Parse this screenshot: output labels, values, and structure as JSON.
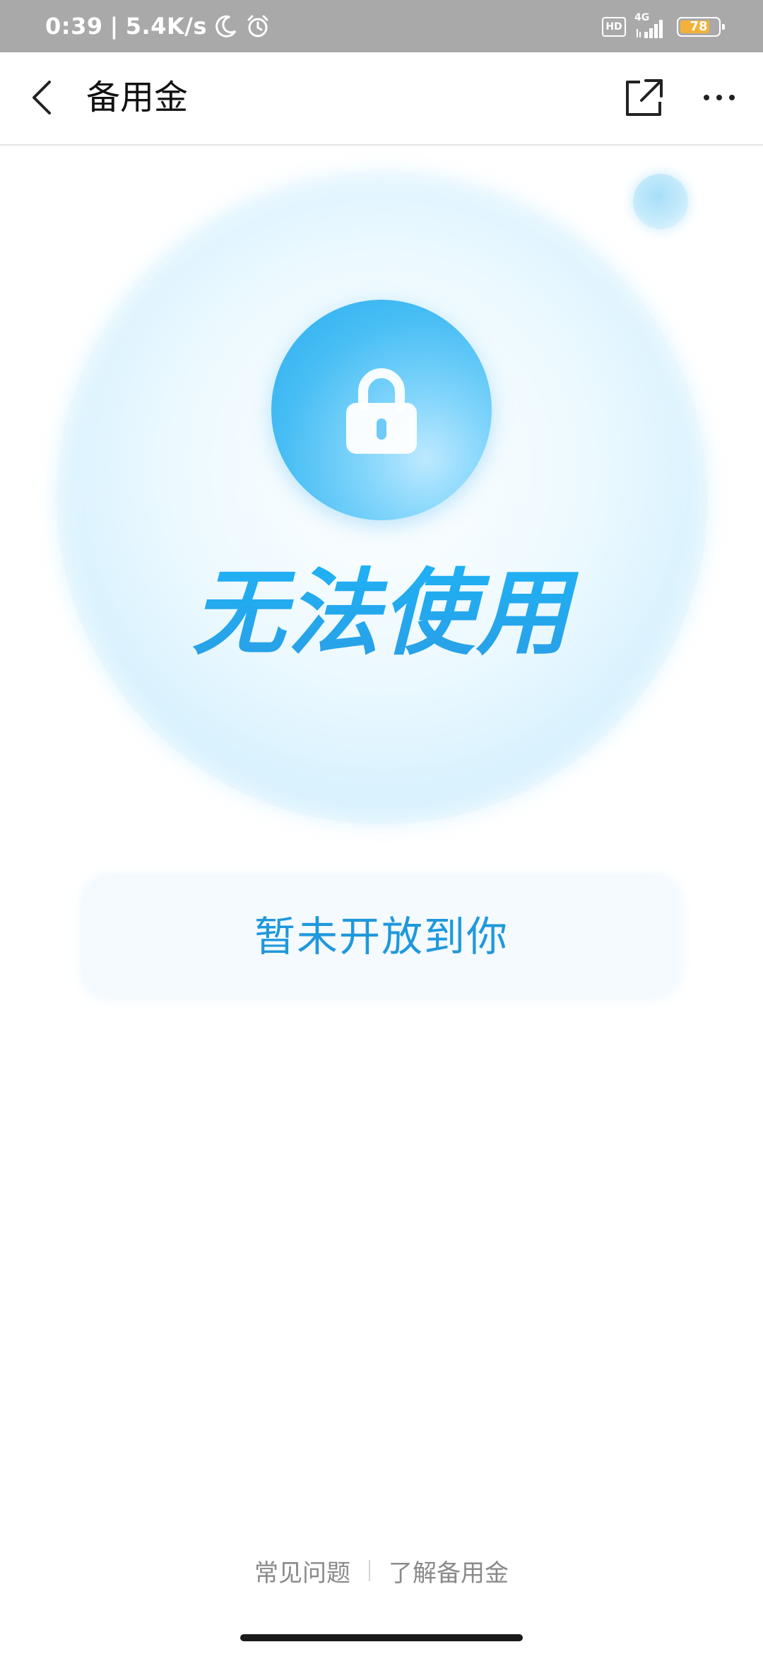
{
  "status_bar": {
    "time": "0:39",
    "separator": "|",
    "net_speed": "5.4K/s",
    "hd_label": "HD",
    "network_type": "4G",
    "battery_level": "78",
    "battery_fraction": 0.78,
    "icons": [
      "moon-icon",
      "alarm-icon",
      "signal-icon"
    ]
  },
  "nav": {
    "title": "备用金",
    "back_icon": "chevron-left-icon",
    "share_icon": "share-external-icon",
    "more_icon": "more-horizontal-icon"
  },
  "hero": {
    "title": "无法使用",
    "icon": "lock-icon",
    "accent_color": "#2aa6ea"
  },
  "notice": {
    "text": "暂未开放到你",
    "text_color": "#1f98dc",
    "background": "#f4fafe"
  },
  "footer": {
    "faq_label": "常见问题",
    "learn_label": "了解备用金"
  }
}
